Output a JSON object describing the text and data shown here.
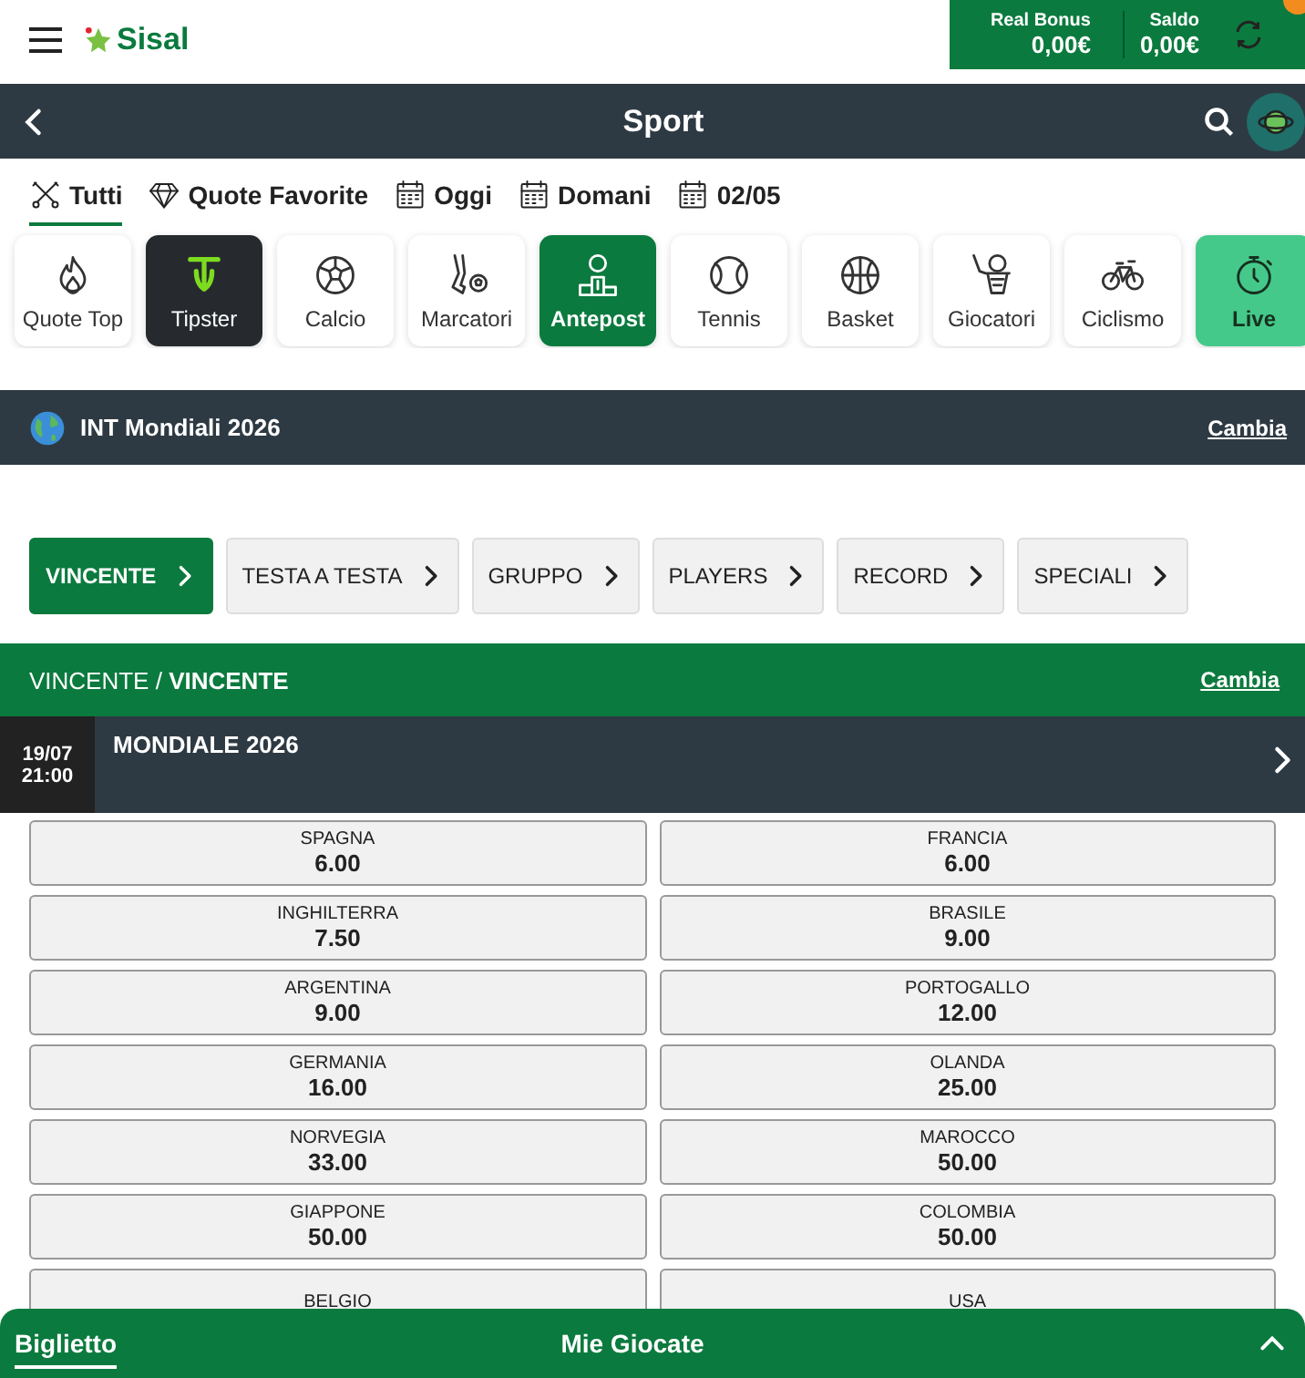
{
  "header": {
    "logo": "Sisal",
    "balances": [
      {
        "label": "Real Bonus",
        "value": "0,00€"
      },
      {
        "label": "Saldo",
        "value": "0,00€"
      }
    ],
    "notification": true
  },
  "nav": {
    "title": "Sport"
  },
  "filters": [
    {
      "label": "Tutti",
      "selected": true
    },
    {
      "label": "Quote Favorite",
      "selected": false
    },
    {
      "label": "Oggi",
      "selected": false
    },
    {
      "label": "Domani",
      "selected": false
    },
    {
      "label": "02/05",
      "selected": false
    }
  ],
  "sports": [
    {
      "label": "Quote Top",
      "kind": "sport",
      "selected": false
    },
    {
      "label": "Tipster",
      "kind": "tipster",
      "selected": false
    },
    {
      "label": "Calcio",
      "kind": "sport",
      "selected": false
    },
    {
      "label": "Marcatori",
      "kind": "sport",
      "selected": false
    },
    {
      "label": "Antepost",
      "kind": "sport",
      "selected": true
    },
    {
      "label": "Tennis",
      "kind": "sport",
      "selected": false
    },
    {
      "label": "Basket",
      "kind": "sport",
      "selected": false
    },
    {
      "label": "Giocatori",
      "kind": "sport",
      "selected": false
    },
    {
      "label": "Ciclismo",
      "kind": "sport",
      "selected": false
    },
    {
      "label": "Live",
      "kind": "live",
      "selected": false
    }
  ],
  "competition": {
    "title": "INT Mondiali 2026",
    "action": "Cambia"
  },
  "markets": [
    {
      "label": "VINCENTE",
      "selected": true
    },
    {
      "label": "TESTA A TESTA",
      "selected": false
    },
    {
      "label": "GRUPPO",
      "selected": false
    },
    {
      "label": "PLAYERS",
      "selected": false
    },
    {
      "label": "RECORD",
      "selected": false
    },
    {
      "label": "SPECIALI",
      "selected": false
    }
  ],
  "market_bar": {
    "title": "VINCENTE / **VINCENTE**",
    "action": "Cambia"
  },
  "event": {
    "date": "19/07",
    "time": "21:00",
    "name": "MONDIALE 2026"
  },
  "odds": [
    {
      "team": "SPAGNA",
      "odd": "6.00"
    },
    {
      "team": "FRANCIA",
      "odd": "6.00"
    },
    {
      "team": "INGHILTERRA",
      "odd": "7.50"
    },
    {
      "team": "BRASILE",
      "odd": "9.00"
    },
    {
      "team": "ARGENTINA",
      "odd": "9.00"
    },
    {
      "team": "PORTOGALLO",
      "odd": "12.00"
    },
    {
      "team": "GERMANIA",
      "odd": "16.00"
    },
    {
      "team": "OLANDA",
      "odd": "25.00"
    },
    {
      "team": "NORVEGIA",
      "odd": "33.00"
    },
    {
      "team": "MAROCCO",
      "odd": "50.00"
    },
    {
      "team": "GIAPPONE",
      "odd": "50.00"
    },
    {
      "team": "COLOMBIA",
      "odd": "50.00"
    },
    {
      "team": "BELGIO"
    },
    {
      "team": "USA"
    }
  ],
  "bottom_tabs": [
    {
      "label": "Biglietto",
      "selected": true
    },
    {
      "label": "Mie Giocate",
      "selected": false
    }
  ]
}
